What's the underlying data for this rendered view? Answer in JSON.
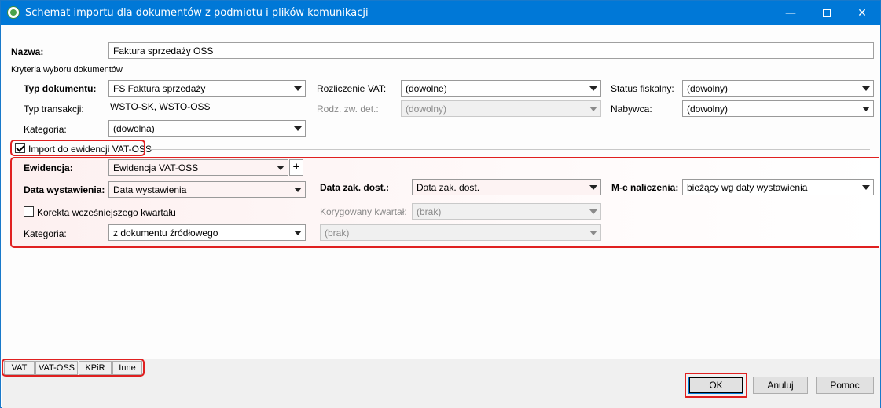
{
  "window": {
    "title": "Schemat importu dla dokumentów z podmiotu i plików komunikacji",
    "controls": {
      "minimize": "—",
      "close": "✕"
    }
  },
  "nazwa": {
    "label": "Nazwa:",
    "value": "Faktura sprzedaży OSS"
  },
  "kryteria": {
    "header": "Kryteria wyboru dokumentów",
    "typ_dokumentu": {
      "label": "Typ dokumentu:",
      "value": "FS Faktura sprzedaży"
    },
    "rozliczenie_vat": {
      "label": "Rozliczenie VAT:",
      "value": "(dowolne)"
    },
    "status_fiskalny": {
      "label": "Status fiskalny:",
      "value": "(dowolny)"
    },
    "typ_transakcji": {
      "label": "Typ transakcji:",
      "value": "WSTO-SK, WSTO-OSS"
    },
    "rodz_zw_det": {
      "label": "Rodz. zw. det.:",
      "value": "(dowolny)"
    },
    "nabywca": {
      "label": "Nabywca:",
      "value": "(dowolny)"
    },
    "kategoria": {
      "label": "Kategoria:",
      "value": "(dowolna)"
    }
  },
  "oss": {
    "import_label": "Import do ewidencji VAT-OSS",
    "import_checked": true,
    "ewidencja": {
      "label": "Ewidencja:",
      "value": "Ewidencja VAT-OSS",
      "add": "+"
    },
    "data_wystawienia": {
      "label": "Data wystawienia:",
      "value": "Data wystawienia"
    },
    "data_zak_dost": {
      "label": "Data zak. dost.:",
      "value": "Data zak. dost."
    },
    "mc_naliczenia": {
      "label": "M-c naliczenia:",
      "value": "bieżący wg daty wystawienia"
    },
    "korekta": {
      "label": "Korekta wcześniejszego kwartału",
      "checked": false
    },
    "korygowany_kwartal": {
      "label": "Korygowany kwartał:",
      "value": "(brak)"
    },
    "kategoria": {
      "label": "Kategoria:",
      "value": "z dokumentu źródłowego"
    },
    "kategoria_extra": {
      "value": "(brak)"
    }
  },
  "tabs": [
    "VAT",
    "VAT-OSS",
    "KPiR",
    "Inne"
  ],
  "buttons": {
    "ok": "OK",
    "cancel": "Anuluj",
    "help": "Pomoc"
  },
  "colors": {
    "titlebar": "#0078d7",
    "highlight": "#e02020"
  }
}
